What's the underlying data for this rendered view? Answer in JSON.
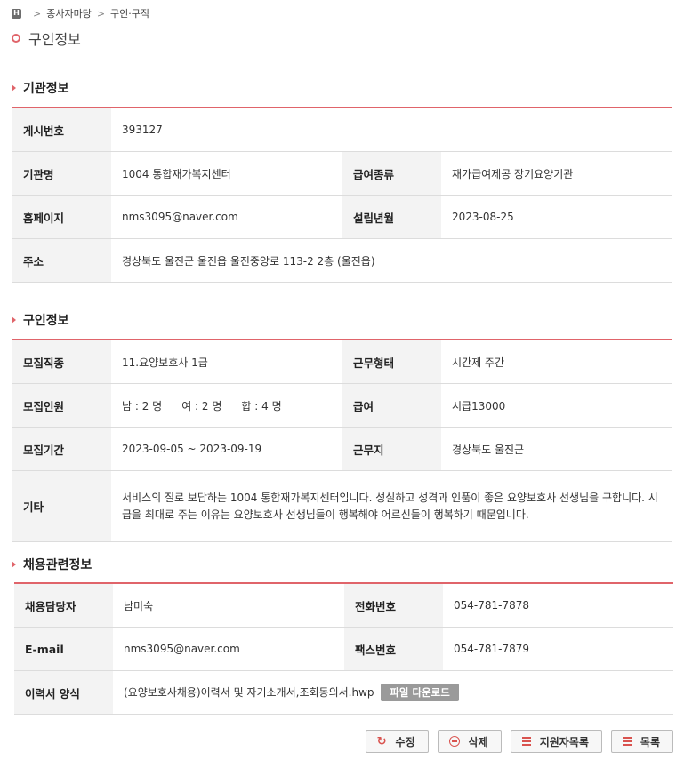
{
  "breadcrumb": {
    "home_icon_text": "H",
    "items": [
      "종사자마당",
      "구인·구직"
    ]
  },
  "page_title": "구인정보",
  "org_section": {
    "title": "기관정보",
    "post_no_label": "게시번호",
    "post_no": "393127",
    "org_name_label": "기관명",
    "org_name": "1004 통합재가복지센터",
    "benefit_type_label": "급여종류",
    "benefit_type": "재가급여제공 장기요양기관",
    "homepage_label": "홈페이지",
    "homepage": "nms3095@naver.com",
    "established_label": "설립년월",
    "established": "2023-08-25",
    "address_label": "주소",
    "address": "경상북도 울진군 울진읍 울진중앙로 113-2 2층 (울진읍)"
  },
  "job_section": {
    "title": "구인정보",
    "position_label": "모집직종",
    "position": "11.요양보호사 1급",
    "work_type_label": "근무형태",
    "work_type": "시간제 주간",
    "headcount_label": "모집인원",
    "male": "남 : 2 명",
    "female": "여 : 2 명",
    "total": "합 : 4 명",
    "wage_label": "급여",
    "wage": "시급13000",
    "period_label": "모집기간",
    "period": "2023-09-05 ~ 2023-09-19",
    "location_label": "근무지",
    "location": "경상북도 울진군",
    "etc_label": "기타",
    "etc": "서비스의 질로 보답하는 1004 통합재가복지센터입니다. 성실하고 성격과 인품이 좋은 요양보호사 선생님을 구합니다. 시급을 최대로 주는 이유는 요양보호사 선생님들이 행복해야 어르신들이 행복하기 때문입니다."
  },
  "hire_section": {
    "title": "채용관련정보",
    "manager_label": "채용담당자",
    "manager": "남미숙",
    "phone_label": "전화번호",
    "phone": "054-781-7878",
    "email_label": "E-mail",
    "email": "nms3095@naver.com",
    "fax_label": "팩스번호",
    "fax": "054-781-7879",
    "resume_label": "이력서 양식",
    "resume_file": "(요양보호사채용)이력서 및 자기소개서,조회동의서.hwp",
    "download_label": "파일 다운로드"
  },
  "buttons": {
    "edit": "수정",
    "delete": "삭제",
    "applicants": "지원자목록",
    "list": "목록"
  },
  "colors": {
    "accent": "#e0646a",
    "header_bg": "#f3f3f3",
    "download_bg": "#9a9a9a"
  }
}
